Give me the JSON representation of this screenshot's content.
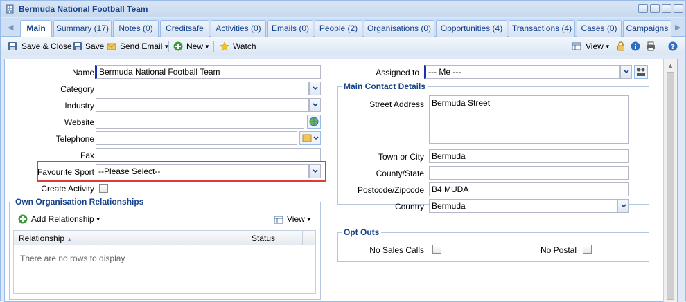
{
  "window": {
    "title": "Bermuda National Football Team"
  },
  "tabs": [
    {
      "label": "Main",
      "active": true
    },
    {
      "label": "Summary (17)"
    },
    {
      "label": "Notes (0)"
    },
    {
      "label": "Creditsafe"
    },
    {
      "label": "Activities (0)"
    },
    {
      "label": "Emails (0)"
    },
    {
      "label": "People (2)"
    },
    {
      "label": "Organisations (0)"
    },
    {
      "label": "Opportunities (4)"
    },
    {
      "label": "Transactions (4)"
    },
    {
      "label": "Cases (0)"
    },
    {
      "label": "Campaigns"
    }
  ],
  "toolbar": {
    "save_close": "Save & Close",
    "save": "Save",
    "send_email": "Send Email",
    "new": "New",
    "watch": "Watch",
    "view": "View"
  },
  "form": {
    "name": {
      "label": "Name",
      "value": "Bermuda National Football Team"
    },
    "category": {
      "label": "Category",
      "value": ""
    },
    "industry": {
      "label": "Industry",
      "value": ""
    },
    "website": {
      "label": "Website",
      "value": ""
    },
    "telephone": {
      "label": "Telephone",
      "value": ""
    },
    "fax": {
      "label": "Fax",
      "value": ""
    },
    "favourite_sport": {
      "label": "Favourite Sport",
      "value": "--Please Select--"
    },
    "create_activity": {
      "label": "Create Activity",
      "checked": false
    },
    "assigned_to": {
      "label": "Assigned to",
      "value": "--- Me ---"
    }
  },
  "own_relationships": {
    "legend": "Own Organisation Relationships",
    "add_button": "Add Relationship",
    "view_button": "View",
    "columns": [
      "Relationship",
      "Status"
    ],
    "empty_text": "There are no rows to display"
  },
  "main_contact": {
    "legend": "Main Contact Details",
    "street": {
      "label": "Street Address",
      "value": "Bermuda Street"
    },
    "town": {
      "label": "Town or City",
      "value": "Bermuda"
    },
    "county": {
      "label": "County/State",
      "value": ""
    },
    "postcode": {
      "label": "Postcode/Zipcode",
      "value": "B4 MUDA"
    },
    "country": {
      "label": "Country",
      "value": "Bermuda"
    }
  },
  "opt_outs": {
    "legend": "Opt Outs",
    "no_sales_calls": {
      "label": "No Sales Calls",
      "checked": false
    },
    "no_postal": {
      "label": "No Postal",
      "checked": false
    }
  },
  "colors": {
    "accent": "#15428b",
    "highlight": "#e03b3b",
    "required": "#1a2fb0"
  }
}
